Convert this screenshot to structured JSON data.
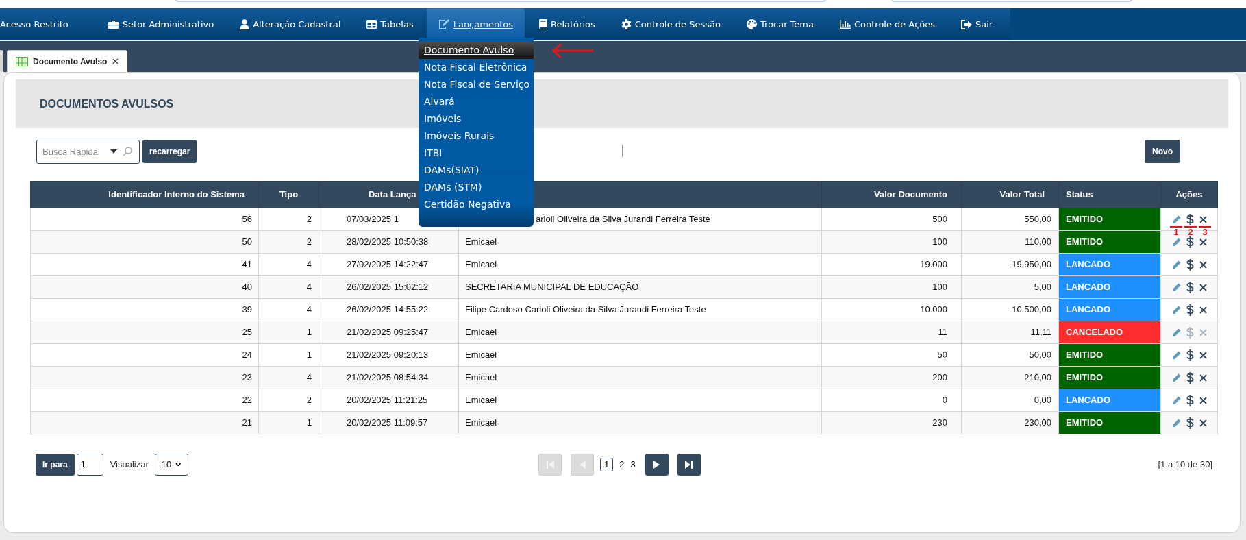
{
  "navbar": {
    "items": [
      {
        "label": "Acesso Restrito",
        "selected": false
      },
      {
        "label": "Setor Administrativo",
        "selected": false
      },
      {
        "label": "Alteração Cadastral",
        "selected": false
      },
      {
        "label": "Tabelas",
        "selected": false
      },
      {
        "label": "Lançamentos",
        "selected": true
      },
      {
        "label": "Relatórios",
        "selected": false
      },
      {
        "label": "Controle de Sessão",
        "selected": false
      },
      {
        "label": "Trocar Tema",
        "selected": false
      },
      {
        "label": "Controle de Ações",
        "selected": false
      },
      {
        "label": "Sair",
        "selected": false
      }
    ]
  },
  "dropdown": {
    "items": [
      {
        "label": "Documento Avulso",
        "selected": true
      },
      {
        "label": "Nota Fiscal Eletrônica",
        "selected": false
      },
      {
        "label": "Nota Fiscal de Serviço",
        "selected": false
      },
      {
        "label": "Alvará",
        "selected": false
      },
      {
        "label": "Imóveis",
        "selected": false
      },
      {
        "label": "Imóveis Rurais",
        "selected": false
      },
      {
        "label": "ITBI",
        "selected": false
      },
      {
        "label": "DAMs(SIAT)",
        "selected": false
      },
      {
        "label": "DAMs (STM)",
        "selected": false
      },
      {
        "label": "Certidão Negativa",
        "selected": false
      }
    ]
  },
  "tabs": [
    {
      "label": "Documento Avulso",
      "close": "×"
    }
  ],
  "page": {
    "title": "DOCUMENTOS AVULSOS"
  },
  "toolbar": {
    "search": {
      "placeholder": "Busca Rapida"
    },
    "reload_button": "recarregar",
    "new_button": "Novo"
  },
  "table": {
    "columns": [
      "Identificador Interno do Sistema",
      "Tipo",
      "Data Lança",
      "Valor Documento",
      "Valor Total",
      "Status",
      "Ações"
    ],
    "rows": [
      {
        "id": "56",
        "tipo": "2",
        "date": "07/03/2025 1",
        "name": "arioli Oliveira da Silva Jurandi Ferreira Teste",
        "valor": "500",
        "total": "550,00",
        "status": "EMITIDO",
        "color": "#006400",
        "actions_disabled": false
      },
      {
        "id": "50",
        "tipo": "2",
        "date": "28/02/2025 10:50:38",
        "name": "Emicael",
        "valor": "100",
        "total": "110,00",
        "status": "EMITIDO",
        "color": "#006400",
        "actions_disabled": false
      },
      {
        "id": "41",
        "tipo": "4",
        "date": "27/02/2025 14:22:47",
        "name": "Emicael",
        "valor": "19.000",
        "total": "19.950,00",
        "status": "LANCADO",
        "color": "#1e90ff",
        "actions_disabled": false
      },
      {
        "id": "40",
        "tipo": "4",
        "date": "26/02/2025 15:02:12",
        "name": "SECRETARIA MUNICIPAL DE EDUCAÇÃO",
        "valor": "100",
        "total": "5,00",
        "status": "LANCADO",
        "color": "#1e90ff",
        "actions_disabled": false
      },
      {
        "id": "39",
        "tipo": "4",
        "date": "26/02/2025 14:55:22",
        "name": "Filipe Cardoso Carioli Oliveira da Silva Jurandi Ferreira Teste",
        "valor": "10.000",
        "total": "10.500,00",
        "status": "LANCADO",
        "color": "#1e90ff",
        "actions_disabled": false
      },
      {
        "id": "25",
        "tipo": "1",
        "date": "21/02/2025 09:25:47",
        "name": "Emicael",
        "valor": "11",
        "total": "11,11",
        "status": "CANCELADO",
        "color": "#ff2d2d",
        "actions_disabled": true
      },
      {
        "id": "24",
        "tipo": "1",
        "date": "21/02/2025 09:20:13",
        "name": "Emicael",
        "valor": "50",
        "total": "50,00",
        "status": "EMITIDO",
        "color": "#006400",
        "actions_disabled": false
      },
      {
        "id": "23",
        "tipo": "4",
        "date": "21/02/2025 08:54:34",
        "name": "Emicael",
        "valor": "200",
        "total": "210,00",
        "status": "EMITIDO",
        "color": "#006400",
        "actions_disabled": false
      },
      {
        "id": "22",
        "tipo": "2",
        "date": "20/02/2025 11:21:25",
        "name": "Emicael",
        "valor": "0",
        "total": "0,00",
        "status": "LANCADO",
        "color": "#1e90ff",
        "actions_disabled": false
      },
      {
        "id": "21",
        "tipo": "1",
        "date": "20/02/2025 11:09:57",
        "name": "Emicael",
        "valor": "230",
        "total": "230,00",
        "status": "EMITIDO",
        "color": "#006400",
        "actions_disabled": false
      }
    ]
  },
  "annotations": {
    "numbers": [
      "1",
      "2",
      "3"
    ]
  },
  "pagination": {
    "goto_button": "Ir para",
    "goto_value": "1",
    "view_label": "Visualizar",
    "page_size": "10",
    "pages": [
      {
        "label": "1",
        "selected": true
      },
      {
        "label": "2",
        "selected": false
      },
      {
        "label": "3",
        "selected": false
      }
    ],
    "first_disabled": true,
    "prev_disabled": true,
    "next_disabled": false,
    "last_disabled": false,
    "summary": "[1 a 10 de 30]"
  }
}
